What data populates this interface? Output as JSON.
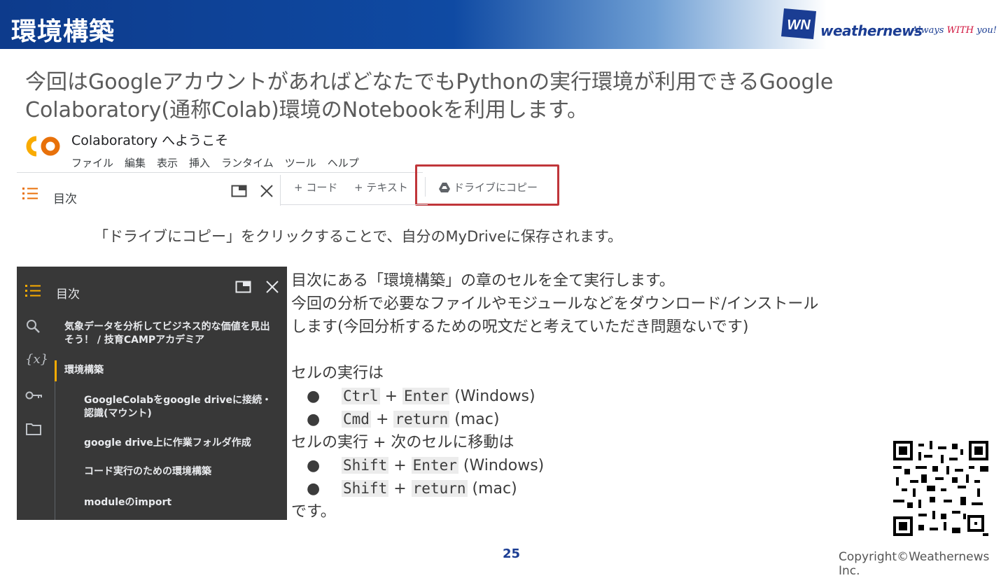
{
  "header": {
    "title": "環境構築"
  },
  "brand": {
    "logo_text": "WN",
    "name": "weathernews",
    "tagline_pre": "Always ",
    "tagline_em": "WITH",
    "tagline_post": " you!"
  },
  "intro": "今回はGoogleアカウントがあればどなたでもPythonの実行環境が利用できるGoogle Colaboratory(通称Colab)環境のNotebookを利用します。",
  "colab": {
    "title": "Colaboratory へようこそ",
    "menu": [
      "ファイル",
      "編集",
      "表示",
      "挿入",
      "ランタイム",
      "ツール",
      "ヘルプ"
    ],
    "toc_label": "目次",
    "add_code": "+ コード",
    "add_text": "+ テキスト",
    "copy_to_drive": "ドライブにコピー"
  },
  "note": "「ドライブにコピー」をクリックすることで、自分のMyDriveに保存されます。",
  "toc_panel": {
    "title": "目次",
    "items": [
      "気象データを分析してビジネス的な価値を見出そう！ / 技育CAMPアカデミア",
      "環境構築",
      "GoogleColabをgoogle driveに接続・認識(マウント)",
      "google drive上に作業フォルダ作成",
      "コード実行のための環境構築",
      "moduleのimport"
    ]
  },
  "instructions": {
    "line1": "目次にある「環境構築」の章のセルを全て実行します。",
    "line2": "今回の分析で必要なファイルやモジュールなどをダウンロード/インストール",
    "line3": "します(今回分析するための呪文だと考えていただき問題ないです)",
    "run_heading": "セルの実行は",
    "run_next_heading": "セルの実行 + 次のセルに移動は",
    "ending": "です。",
    "bullet": "●",
    "plus": "+",
    "shortcuts": [
      {
        "k1": "Ctrl",
        "k2": "Enter",
        "os": "(Windows)"
      },
      {
        "k1": "Cmd",
        "k2": "return",
        "os": "(mac)"
      },
      {
        "k1": "Shift",
        "k2": "Enter",
        "os": "(Windows)"
      },
      {
        "k1": "Shift",
        "k2": "return",
        "os": "(mac)"
      }
    ]
  },
  "footer": {
    "page": "25",
    "copyright": "Copyright©Weathernews Inc."
  },
  "colors": {
    "brand_blue": "#1b3d93",
    "highlight_red": "#c0363a",
    "colab_orange": "#f9ab00"
  }
}
